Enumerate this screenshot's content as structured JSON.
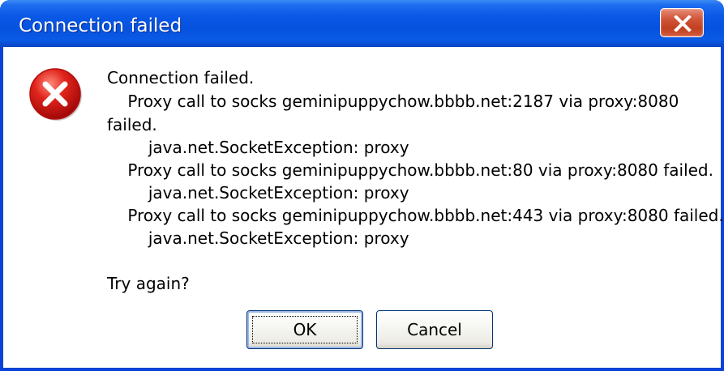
{
  "window": {
    "title": "Connection failed",
    "close_icon": "close-icon"
  },
  "dialog": {
    "icon": "error-icon",
    "message_lines": [
      "Connection failed.",
      "    Proxy call to socks geminipuppychow.bbbb.net:2187 via proxy:8080",
      "failed.",
      "        java.net.SocketException: proxy",
      "    Proxy call to socks geminipuppychow.bbbb.net:80 via proxy:8080 failed.",
      "        java.net.SocketException: proxy",
      "    Proxy call to socks geminipuppychow.bbbb.net:443 via proxy:8080 failed.",
      "        java.net.SocketException: proxy"
    ],
    "question": "Try again?",
    "ok_label": "OK",
    "cancel_label": "Cancel"
  },
  "colors": {
    "titlebar": "#0552df",
    "close_button": "#c2401f",
    "error_icon": "#cc1010"
  }
}
